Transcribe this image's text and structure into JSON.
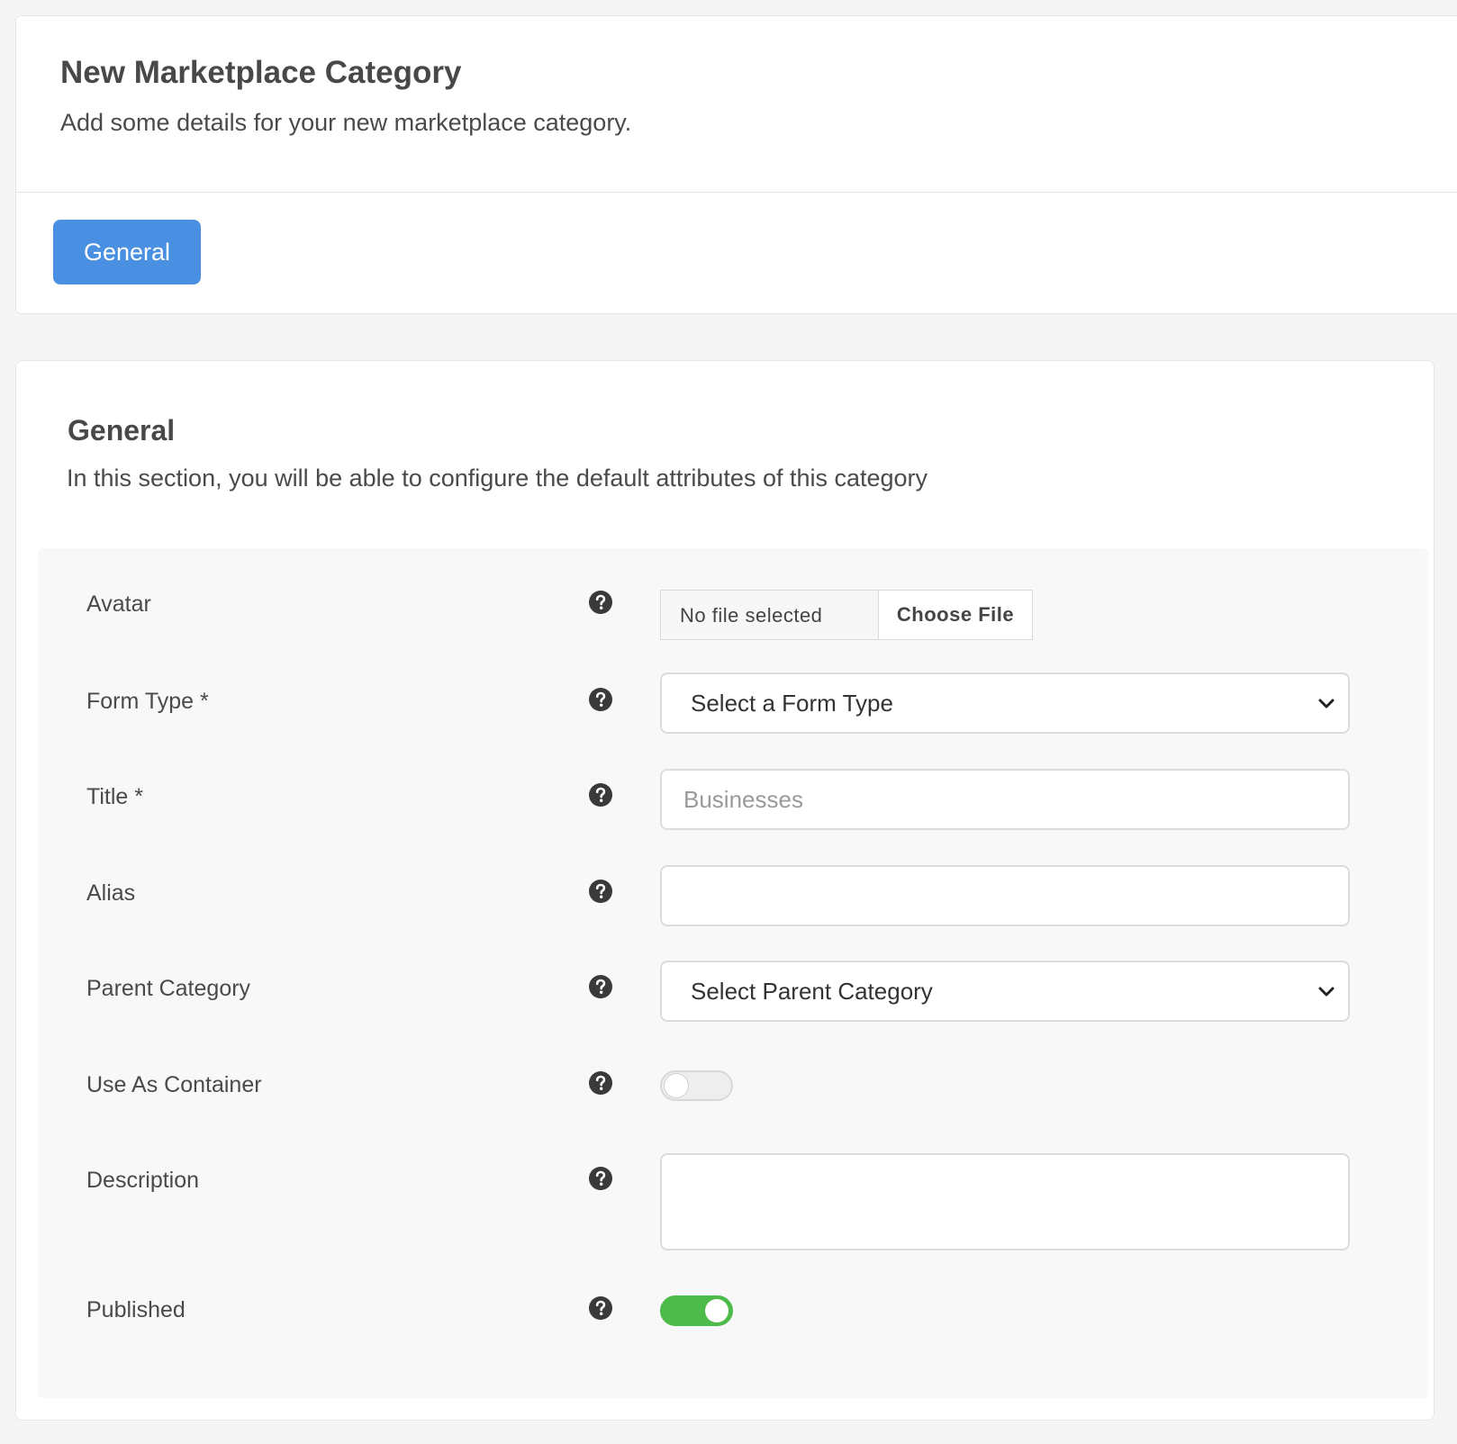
{
  "header": {
    "title": "New Marketplace Category",
    "subtitle": "Add some details for your new marketplace category.",
    "tabs": [
      {
        "label": "General",
        "active": true
      }
    ]
  },
  "section": {
    "title": "General",
    "description": "In this section, you will be able to configure the default attributes of this category"
  },
  "form": {
    "avatar": {
      "label": "Avatar",
      "file_status": "No file selected",
      "button_label": "Choose File"
    },
    "form_type": {
      "label": "Form Type *",
      "selected": "Select a Form Type"
    },
    "title": {
      "label": "Title *",
      "value": "",
      "placeholder": "Businesses"
    },
    "alias": {
      "label": "Alias",
      "value": ""
    },
    "parent_category": {
      "label": "Parent Category",
      "selected": "Select Parent Category"
    },
    "use_as_container": {
      "label": "Use As Container",
      "enabled": false
    },
    "description": {
      "label": "Description",
      "value": ""
    },
    "published": {
      "label": "Published",
      "enabled": true
    }
  },
  "icons": {
    "help": "question-circle-icon",
    "select_arrow": "chevron-down-icon"
  },
  "colors": {
    "accent": "#4a90e2",
    "toggle_on": "#4cbb4a",
    "toggle_off": "#eeeeee",
    "panel_bg": "#f8f8f8",
    "page_bg": "#f5f5f5"
  }
}
